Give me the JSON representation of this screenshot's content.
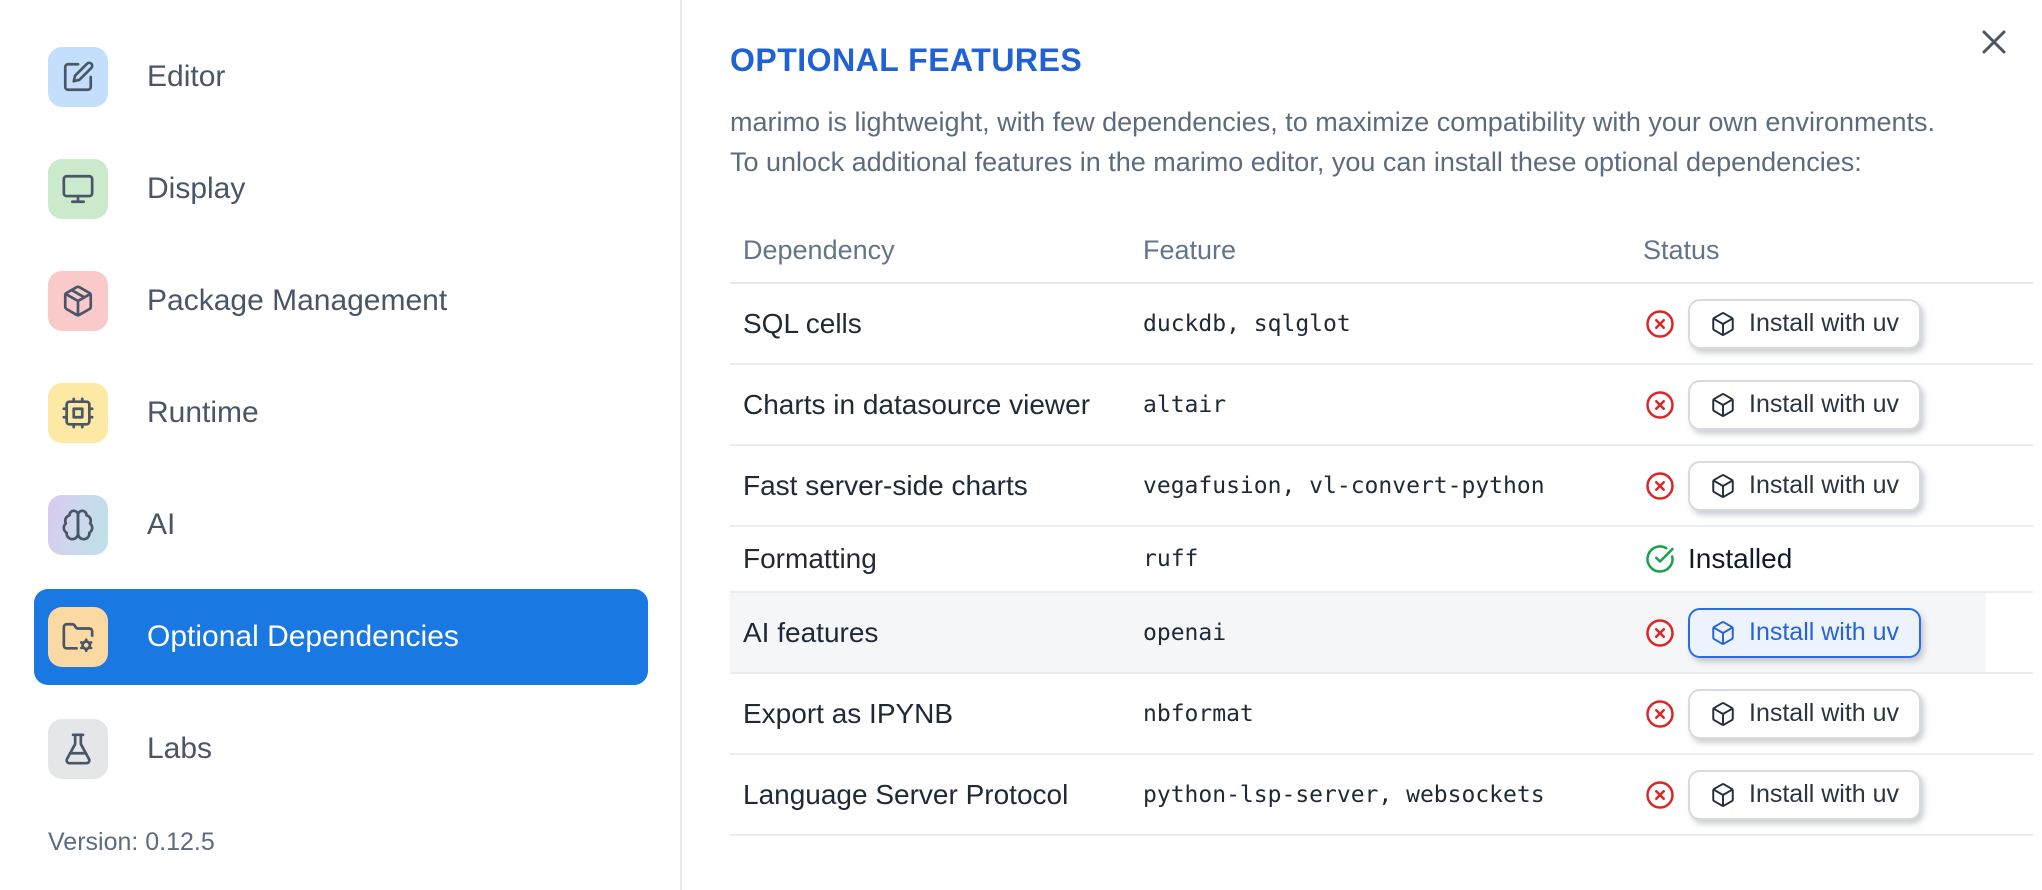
{
  "sidebar": {
    "items": [
      {
        "label": "Editor",
        "icon": "edit-icon",
        "tile_bg": "#c3dffb"
      },
      {
        "label": "Display",
        "icon": "monitor-icon",
        "tile_bg": "#cbe9cb"
      },
      {
        "label": "Package Management",
        "icon": "package-icon",
        "tile_bg": "#fac9c9"
      },
      {
        "label": "Runtime",
        "icon": "cpu-icon",
        "tile_bg": "#fbe9a4"
      },
      {
        "label": "AI",
        "icon": "brain-icon",
        "tile_bg": "linear-gradient(105deg,#d9c9ee 0%,#cdd7ee 45%,#bbe2e6 100%)"
      },
      {
        "label": "Optional Dependencies",
        "icon": "folder-cog-icon",
        "tile_bg": "#fbd9a3",
        "selected": true
      },
      {
        "label": "Labs",
        "icon": "flask-icon",
        "tile_bg": "#e5e6e8"
      }
    ],
    "version_label": "Version: 0.12.5"
  },
  "panel": {
    "title": "OPTIONAL FEATURES",
    "description_line1": "marimo is lightweight, with few dependencies, to maximize compatibility with your own environments.",
    "description_line2": "To unlock additional features in the marimo editor, you can install these optional dependencies:",
    "close_icon": "x",
    "table": {
      "columns": [
        "Dependency",
        "Feature",
        "Status"
      ],
      "rows": [
        {
          "dependency": "SQL cells",
          "feature": "duckdb, sqlglot",
          "status": "missing",
          "action": "Install with uv"
        },
        {
          "dependency": "Charts in datasource viewer",
          "feature": "altair",
          "status": "missing",
          "action": "Install with uv"
        },
        {
          "dependency": "Fast server-side charts",
          "feature": "vegafusion, vl-convert-python",
          "status": "missing",
          "action": "Install with uv"
        },
        {
          "dependency": "Formatting",
          "feature": "ruff",
          "status": "installed",
          "status_text": "Installed"
        },
        {
          "dependency": "AI features",
          "feature": "openai",
          "status": "missing",
          "action": "Install with uv",
          "highlighted": true
        },
        {
          "dependency": "Export as IPYNB",
          "feature": "nbformat",
          "status": "missing",
          "action": "Install with uv"
        },
        {
          "dependency": "Language Server Protocol",
          "feature": "python-lsp-server, websockets",
          "status": "missing",
          "action": "Install with uv"
        }
      ]
    }
  },
  "colors": {
    "selected_nav_bg": "#1a78e2",
    "title_blue": "#2061d4",
    "focused_button_blue": "#2563d6",
    "error_red": "#dc2626",
    "success_green": "#16a34a",
    "row_border": "#e9edf2",
    "hover_row_bg": "#f5f6f8"
  }
}
